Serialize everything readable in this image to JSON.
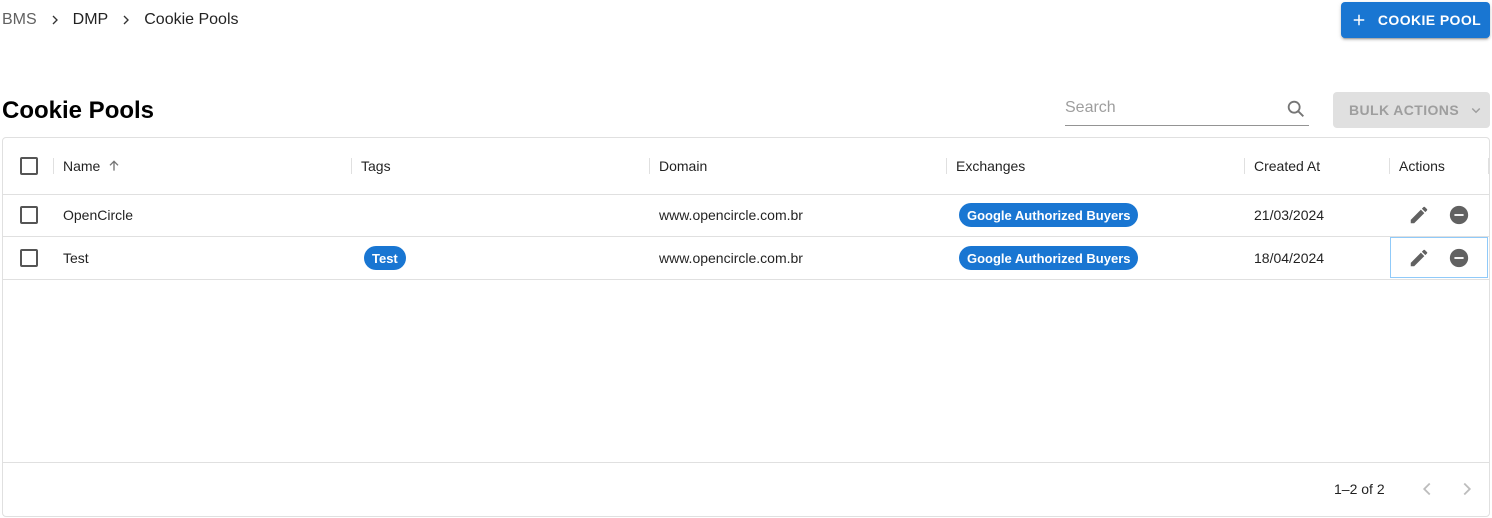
{
  "breadcrumb": {
    "items": [
      "BMS",
      "DMP",
      "Cookie Pools"
    ]
  },
  "header": {
    "add_button_label": "COOKIE POOL"
  },
  "page": {
    "title": "Cookie Pools"
  },
  "search": {
    "placeholder": "Search",
    "value": ""
  },
  "bulk_actions": {
    "label": "BULK ACTIONS"
  },
  "table": {
    "columns": [
      "Name",
      "Tags",
      "Domain",
      "Exchanges",
      "Created At",
      "Actions"
    ],
    "sort": {
      "column": "Name",
      "direction": "asc"
    },
    "rows": [
      {
        "name": "OpenCircle",
        "tags": [],
        "domain": "www.opencircle.com.br",
        "exchanges": [
          "Google Authorized Buyers"
        ],
        "created_at": "21/03/2024"
      },
      {
        "name": "Test",
        "tags": [
          "Test"
        ],
        "domain": "www.opencircle.com.br",
        "exchanges": [
          "Google Authorized Buyers"
        ],
        "created_at": "18/04/2024"
      }
    ]
  },
  "pagination": {
    "text": "1–2 of 2"
  },
  "colors": {
    "primary": "#1976d2",
    "disabled_bg": "#e0e0e0",
    "border": "#e0e0e0"
  }
}
